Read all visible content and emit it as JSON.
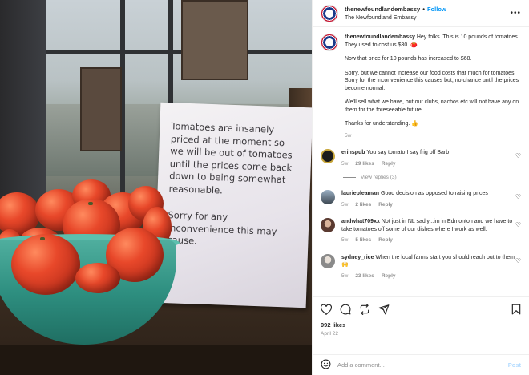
{
  "post": {
    "username": "thenewfoundlandembassy",
    "follow_label": "Follow",
    "location": "The Newfoundland Embassy",
    "more_icon": "more-horizontal-icon",
    "photo_sign_text": "Tomatoes are insanely\npriced at the moment so\nwe will be out of tomatoes\nuntil the prices come back\ndown to being somewhat\nreasonable.",
    "photo_sign_text2": "Sorry for any\ninconvenience this may\ncause."
  },
  "caption": {
    "username": "thenewfoundlandembassy",
    "lines": [
      "Hey folks. This is 10 pounds of tomatoes. They used to cost us $30. 🍅",
      "Now that price for 10 pounds has increased to $68.",
      "Sorry, but we cannot increase our food costs that much for tomatoes. Sorry for the inconvenience this causes but, no chance until the prices become normal.",
      "We'll sell what we have, but our clubs, nachos etc will not have any on them for the foreseeable future.",
      "Thanks for understanding. 👍"
    ],
    "time": "5w"
  },
  "comments": [
    {
      "username": "erinspub",
      "text": "You say tomato I say frig off Barb",
      "time": "5w",
      "likes": "29 likes",
      "reply": "Reply",
      "avatar_color": "#1b1b1b",
      "view_replies": "View replies (3)"
    },
    {
      "username": "lauriepleaman",
      "text": "Good decision as opposed to raising prices",
      "time": "5w",
      "likes": "2 likes",
      "reply": "Reply",
      "avatar_color": "#5c6b7a"
    },
    {
      "username": "andwhat709xx",
      "text": "Not just in NL sadly...im in Edmonton and we have to take tomatoes off some of our dishes where I work as well.",
      "time": "5w",
      "likes": "5 likes",
      "reply": "Reply",
      "avatar_color": "#8a5a4a"
    },
    {
      "username": "sydney_rice",
      "text": "When the local farms start you should reach out to them 🙌",
      "time": "5w",
      "likes": "23 likes",
      "reply": "Reply",
      "avatar_color": "#9a9a9a"
    }
  ],
  "stats": {
    "likes": "992 likes",
    "date": "April 22"
  },
  "add_comment": {
    "placeholder": "Add a comment...",
    "post_label": "Post"
  },
  "colors": {
    "accent": "#0095f6",
    "post_disabled": "#b3dbff",
    "muted": "#8e8e8e"
  }
}
